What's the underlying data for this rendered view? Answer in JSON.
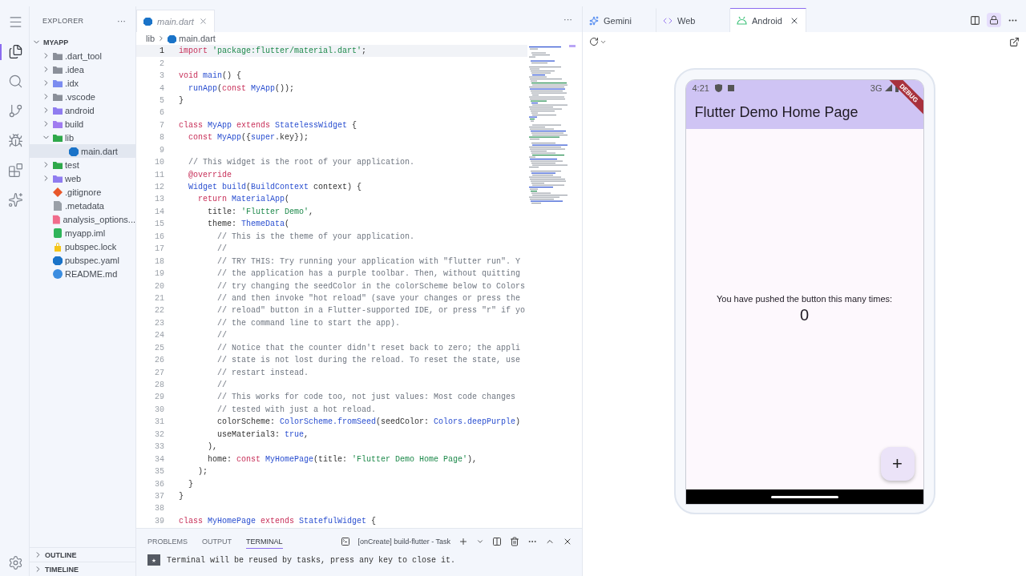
{
  "activity_bar": {
    "items": [
      {
        "kind": "menu",
        "selected": false
      },
      {
        "kind": "explorer",
        "selected": true
      },
      {
        "kind": "search",
        "selected": false
      },
      {
        "kind": "source-control",
        "selected": false
      },
      {
        "kind": "run",
        "selected": false
      },
      {
        "kind": "extensions",
        "selected": false
      },
      {
        "kind": "firebase",
        "selected": false
      }
    ],
    "settings": {
      "kind": "settings"
    }
  },
  "explorer": {
    "title": "EXPLORER",
    "more": "···",
    "root": {
      "name": "MYAPP",
      "expanded": true
    },
    "items": [
      {
        "name": ".dart_tool",
        "kind": "folder",
        "color": "#8a8f99",
        "expanded": false,
        "selected": false
      },
      {
        "name": ".idea",
        "kind": "folder",
        "color": "#8a8f99",
        "expanded": false,
        "selected": false
      },
      {
        "name": ".idx",
        "kind": "folder",
        "color": "#7b8cf0",
        "expanded": false,
        "selected": false
      },
      {
        "name": ".vscode",
        "kind": "folder",
        "color": "#8a8f99",
        "expanded": false,
        "selected": false
      },
      {
        "name": "android",
        "kind": "folder",
        "color": "#8f7cf0",
        "expanded": false,
        "selected": false
      },
      {
        "name": "build",
        "kind": "folder",
        "color": "#a07cf0",
        "expanded": false,
        "selected": false
      },
      {
        "name": "lib",
        "kind": "folder",
        "color": "#2ea84a",
        "expanded": true,
        "selected": false,
        "children": [
          {
            "name": "main.dart",
            "kind": "dart",
            "color": "#1a73c8",
            "selected": true
          }
        ]
      },
      {
        "name": "test",
        "kind": "folder",
        "color": "#2ea84a",
        "expanded": false,
        "selected": false
      },
      {
        "name": "web",
        "kind": "folder",
        "color": "#8f7cf0",
        "expanded": false,
        "selected": false
      },
      {
        "name": ".gitignore",
        "kind": "git",
        "color": "#e8572a",
        "selected": false
      },
      {
        "name": ".metadata",
        "kind": "file",
        "color": "#9aa0a8",
        "selected": false
      },
      {
        "name": "analysis_options...",
        "kind": "file",
        "color": "#f06c8c",
        "selected": false
      },
      {
        "name": "myapp.iml",
        "kind": "xml",
        "color": "#2fb45a",
        "selected": false
      },
      {
        "name": "pubspec.lock",
        "kind": "lock",
        "color": "#f5c518",
        "selected": false
      },
      {
        "name": "pubspec.yaml",
        "kind": "dart",
        "color": "#1a73c8",
        "selected": false
      },
      {
        "name": "README.md",
        "kind": "info",
        "color": "#3b8de0",
        "selected": false
      }
    ],
    "sections": [
      {
        "title": "OUTLINE",
        "expanded": false
      },
      {
        "title": "TIMELINE",
        "expanded": false
      }
    ]
  },
  "editor": {
    "tabs": [
      {
        "label": "main.dart",
        "preview": true,
        "selected": true
      }
    ],
    "more": "···",
    "breadcrumb": [
      "lib",
      "main.dart"
    ],
    "lines": [
      {
        "number": "1",
        "active": true,
        "tokens": [
          {
            "kind": "kw",
            "text": "import "
          },
          {
            "kind": "str",
            "text": "'package:flutter/material.dart'"
          },
          {
            "kind": "plain",
            "text": ";"
          }
        ]
      },
      {
        "number": "2",
        "active": false
      },
      {
        "number": "3",
        "active": false,
        "tokens": [
          {
            "kind": "kw",
            "text": "void "
          },
          {
            "kind": "type",
            "text": "main"
          },
          {
            "kind": "plain",
            "text": "() {"
          }
        ]
      },
      {
        "number": "4",
        "active": false,
        "tokens": [
          {
            "kind": "type",
            "text": "  runApp"
          },
          {
            "kind": "plain",
            "text": "("
          },
          {
            "kind": "kw",
            "text": "const "
          },
          {
            "kind": "type",
            "text": "MyApp"
          },
          {
            "kind": "plain",
            "text": "());"
          }
        ]
      },
      {
        "number": "5",
        "active": false,
        "tokens": [
          {
            "kind": "plain",
            "text": "}"
          }
        ]
      },
      {
        "number": "6",
        "active": false
      },
      {
        "number": "7",
        "active": false,
        "tokens": [
          {
            "kind": "kw",
            "text": "class "
          },
          {
            "kind": "type",
            "text": "MyApp"
          },
          {
            "kind": "kw",
            "text": " extends "
          },
          {
            "kind": "type",
            "text": "StatelessWidget"
          },
          {
            "kind": "plain",
            "text": " {"
          }
        ]
      },
      {
        "number": "8",
        "active": false,
        "tokens": [
          {
            "kind": "kw",
            "text": "  const "
          },
          {
            "kind": "type",
            "text": "MyApp"
          },
          {
            "kind": "plain",
            "text": "({"
          },
          {
            "kind": "type",
            "text": "super"
          },
          {
            "kind": "plain",
            "text": ".key});"
          }
        ]
      },
      {
        "number": "9",
        "active": false
      },
      {
        "number": "10",
        "active": false,
        "tokens": [
          {
            "kind": "comment",
            "text": "  // This widget is the root of your application."
          }
        ]
      },
      {
        "number": "11",
        "active": false,
        "tokens": [
          {
            "kind": "kw",
            "text": "  @override"
          }
        ]
      },
      {
        "number": "12",
        "active": false,
        "tokens": [
          {
            "kind": "type",
            "text": "  Widget build"
          },
          {
            "kind": "plain",
            "text": "("
          },
          {
            "kind": "type",
            "text": "BuildContext"
          },
          {
            "kind": "plain",
            "text": " context) {"
          }
        ]
      },
      {
        "number": "13",
        "active": false,
        "tokens": [
          {
            "kind": "kw",
            "text": "    return "
          },
          {
            "kind": "type",
            "text": "MaterialApp"
          },
          {
            "kind": "plain",
            "text": "("
          }
        ]
      },
      {
        "number": "14",
        "active": false,
        "tokens": [
          {
            "kind": "plain",
            "text": "      title: "
          },
          {
            "kind": "str",
            "text": "'Flutter Demo'"
          },
          {
            "kind": "plain",
            "text": ","
          }
        ]
      },
      {
        "number": "15",
        "active": false,
        "tokens": [
          {
            "kind": "plain",
            "text": "      theme: "
          },
          {
            "kind": "type",
            "text": "ThemeData"
          },
          {
            "kind": "plain",
            "text": "("
          }
        ]
      },
      {
        "number": "16",
        "active": false,
        "tokens": [
          {
            "kind": "comment",
            "text": "        // This is the theme of your application."
          }
        ]
      },
      {
        "number": "17",
        "active": false,
        "tokens": [
          {
            "kind": "comment",
            "text": "        //"
          }
        ]
      },
      {
        "number": "18",
        "active": false,
        "tokens": [
          {
            "kind": "comment",
            "text": "        // TRY THIS: Try running your application with \"flutter run\". Y"
          }
        ]
      },
      {
        "number": "19",
        "active": false,
        "tokens": [
          {
            "kind": "comment",
            "text": "        // the application has a purple toolbar. Then, without quitting"
          }
        ]
      },
      {
        "number": "20",
        "active": false,
        "tokens": [
          {
            "kind": "comment",
            "text": "        // try changing the seedColor in the colorScheme below to Colors"
          }
        ]
      },
      {
        "number": "21",
        "active": false,
        "tokens": [
          {
            "kind": "comment",
            "text": "        // and then invoke \"hot reload\" (save your changes or press the"
          }
        ]
      },
      {
        "number": "22",
        "active": false,
        "tokens": [
          {
            "kind": "comment",
            "text": "        // reload\" button in a Flutter-supported IDE, or press \"r\" if yo"
          }
        ]
      },
      {
        "number": "23",
        "active": false,
        "tokens": [
          {
            "kind": "comment",
            "text": "        // the command line to start the app)."
          }
        ]
      },
      {
        "number": "24",
        "active": false,
        "tokens": [
          {
            "kind": "comment",
            "text": "        //"
          }
        ]
      },
      {
        "number": "25",
        "active": false,
        "tokens": [
          {
            "kind": "comment",
            "text": "        // Notice that the counter didn't reset back to zero; the appli"
          }
        ]
      },
      {
        "number": "26",
        "active": false,
        "tokens": [
          {
            "kind": "comment",
            "text": "        // state is not lost during the reload. To reset the state, use"
          }
        ]
      },
      {
        "number": "27",
        "active": false,
        "tokens": [
          {
            "kind": "comment",
            "text": "        // restart instead."
          }
        ]
      },
      {
        "number": "28",
        "active": false,
        "tokens": [
          {
            "kind": "comment",
            "text": "        //"
          }
        ]
      },
      {
        "number": "29",
        "active": false,
        "tokens": [
          {
            "kind": "comment",
            "text": "        // This works for code too, not just values: Most code changes"
          }
        ]
      },
      {
        "number": "30",
        "active": false,
        "tokens": [
          {
            "kind": "comment",
            "text": "        // tested with just a hot reload."
          }
        ]
      },
      {
        "number": "31",
        "active": false,
        "tokens": [
          {
            "kind": "plain",
            "text": "        colorScheme: "
          },
          {
            "kind": "type",
            "text": "ColorScheme.fromSeed"
          },
          {
            "kind": "plain",
            "text": "(seedColor: "
          },
          {
            "kind": "type",
            "text": "Colors.deepPurple"
          },
          {
            "kind": "plain",
            "text": ")"
          }
        ]
      },
      {
        "number": "32",
        "active": false,
        "tokens": [
          {
            "kind": "plain",
            "text": "        useMaterial3: "
          },
          {
            "kind": "type",
            "text": "true"
          },
          {
            "kind": "plain",
            "text": ","
          }
        ]
      },
      {
        "number": "33",
        "active": false,
        "tokens": [
          {
            "kind": "plain",
            "text": "      ),"
          }
        ]
      },
      {
        "number": "34",
        "active": false,
        "tokens": [
          {
            "kind": "plain",
            "text": "      home: "
          },
          {
            "kind": "kw",
            "text": "const "
          },
          {
            "kind": "type",
            "text": "MyHomePage"
          },
          {
            "kind": "plain",
            "text": "(title: "
          },
          {
            "kind": "str",
            "text": "'Flutter Demo Home Page'"
          },
          {
            "kind": "plain",
            "text": "),"
          }
        ]
      },
      {
        "number": "35",
        "active": false,
        "tokens": [
          {
            "kind": "plain",
            "text": "    );"
          }
        ]
      },
      {
        "number": "36",
        "active": false,
        "tokens": [
          {
            "kind": "plain",
            "text": "  }"
          }
        ]
      },
      {
        "number": "37",
        "active": false,
        "tokens": [
          {
            "kind": "plain",
            "text": "}"
          }
        ]
      },
      {
        "number": "38",
        "active": false
      },
      {
        "number": "39",
        "active": false,
        "tokens": [
          {
            "kind": "kw",
            "text": "class "
          },
          {
            "kind": "type",
            "text": "MyHomePage"
          },
          {
            "kind": "kw",
            "text": " extends "
          },
          {
            "kind": "type",
            "text": "StatefulWidget"
          },
          {
            "kind": "plain",
            "text": " {"
          }
        ]
      }
    ]
  },
  "panel": {
    "tabs": [
      {
        "label": "PROBLEMS",
        "selected": false
      },
      {
        "label": "OUTPUT",
        "selected": false
      },
      {
        "label": "TERMINAL",
        "selected": true
      }
    ],
    "task": "[onCreate] build-flutter - Task",
    "badge": "★",
    "message": "Terminal will be reused by tasks, press any key to close it."
  },
  "preview": {
    "tabs": [
      {
        "label": "Gemini",
        "kind": "gemini",
        "selected": false
      },
      {
        "label": "Web",
        "kind": "web",
        "selected": false
      },
      {
        "label": "Android",
        "kind": "android",
        "selected": true
      }
    ],
    "lock": {
      "on": true
    },
    "phone": {
      "time": "4:21",
      "network": "3G",
      "banner": "DEBUG",
      "app_title": "Flutter Demo Home Page",
      "message": "You have pushed the button this many times:",
      "counter": "0",
      "fab": "+"
    }
  }
}
